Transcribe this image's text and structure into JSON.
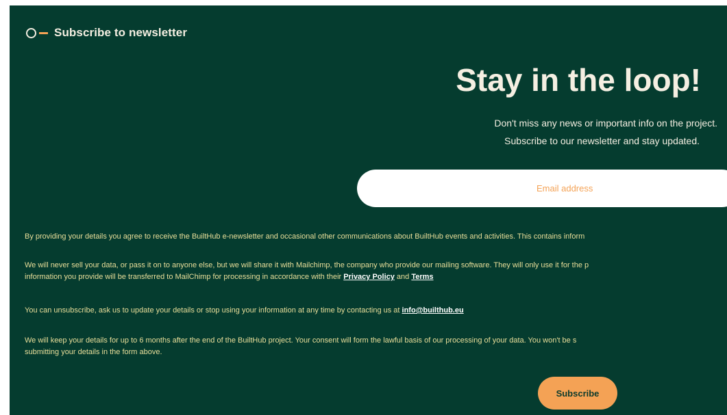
{
  "section": {
    "title": "Subscribe to newsletter"
  },
  "hero": {
    "headline": "Stay in the loop!",
    "line1": "Don't miss any news or important info on the project.",
    "line2": "Subscribe to our newsletter and stay updated."
  },
  "form": {
    "email_placeholder": "Email address",
    "subscribe_label": "Subscribe"
  },
  "legal": {
    "p1": "By providing your details you agree to receive the BuiltHub e-newsletter and occasional other communications about BuiltHub events and activities. This contains inform",
    "p2_line1": "We will never sell your data, or pass it on to anyone else, but we will share it with Mailchimp, the company who provide our mailing software. They will only use it for the p",
    "p2_line2_prefix": "information you provide will be transferred to MailChimp for processing in accordance with their ",
    "privacy_link": "Privacy Policy",
    "and": " and ",
    "terms_link": "Terms",
    "p3_prefix": "You can unsubscribe, ask us to update your details or stop using your information at any time by contacting us at ",
    "email_link": "info@builthub.eu",
    "p4_line1": "We will keep your details for up to 6 months after the end of the BuiltHub project. Your consent will form the lawful basis of our processing of your data. You won't be s",
    "p4_line2": "submitting your details in the form above."
  },
  "colors": {
    "background": "#053c2f",
    "accent": "#f4a255",
    "text": "#f5efe2"
  },
  "icons": {
    "section_marker": "circle-dash-icon"
  }
}
